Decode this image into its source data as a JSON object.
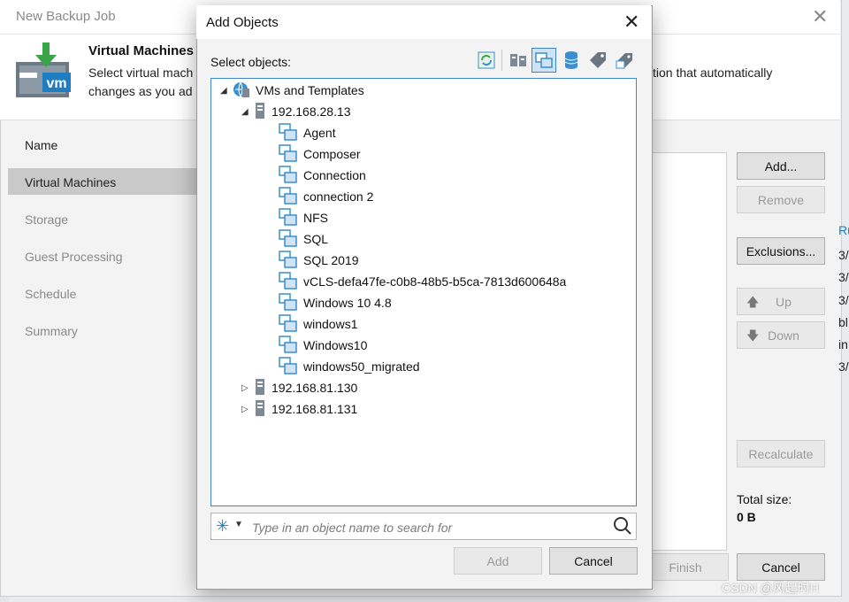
{
  "background_window": {
    "title": "New Backup Job",
    "header_title": "Virtual Machines",
    "header_line1_start": "Select virtual mach",
    "header_line1_end": "tion that automatically",
    "header_line2": "changes as you ad",
    "vm_logo_text": "vm",
    "nav_items": [
      {
        "label": "Name"
      },
      {
        "label": "Virtual Machines"
      },
      {
        "label": "Storage"
      },
      {
        "label": "Guest Processing"
      },
      {
        "label": "Schedule"
      },
      {
        "label": "Summary"
      }
    ],
    "buttons": {
      "add": "Add...",
      "remove": "Remove",
      "exclusions": "Exclusions...",
      "up": "Up",
      "down": "Down",
      "recalculate": "Recalculate",
      "finish": "Finish",
      "cancel": "Cancel"
    },
    "total_size_label": "Total size:",
    "total_size_value": "0 B",
    "side_cutoff": [
      "Ru",
      "3/",
      "3/",
      "3/",
      "bl",
      "in",
      "3/"
    ],
    "watermark": "CSDN @风起时H"
  },
  "dialog": {
    "title": "Add Objects",
    "select_label": "Select objects:",
    "toolbar_icons": [
      "refresh-icon",
      "hosts-and-clusters-icon",
      "vms-and-templates-icon",
      "datastores-icon",
      "tags-icon",
      "vm-tags-icon"
    ],
    "tree": {
      "root": "VMs and Templates",
      "hosts": [
        {
          "name": "192.168.28.13",
          "expanded": true,
          "vms": [
            "Agent",
            "Composer",
            "Connection",
            "connection 2",
            "NFS",
            "SQL",
            "SQL 2019",
            "vCLS-defa47fe-c0b8-48b5-b5ca-7813d600648a",
            "Windows 10 4.8",
            "windows1",
            "Windows10",
            "windows50_migrated"
          ]
        },
        {
          "name": "192.168.81.130",
          "expanded": false
        },
        {
          "name": "192.168.81.131",
          "expanded": false
        }
      ]
    },
    "search_placeholder": "Type in an object name to search for",
    "add_label": "Add",
    "cancel_label": "Cancel"
  },
  "colors": {
    "accent_blue": "#3f86c9",
    "annotation_red": "#e8342a",
    "veeam_green": "#3aa548"
  }
}
